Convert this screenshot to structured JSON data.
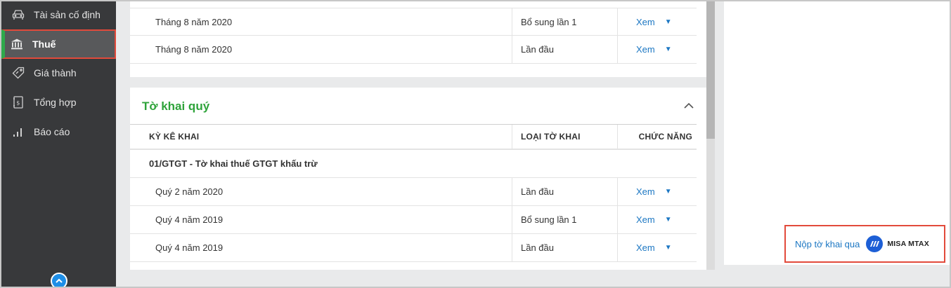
{
  "sidebar": {
    "items": [
      {
        "label": "Tài sản cố định",
        "icon": "car-icon"
      },
      {
        "label": "Thuế",
        "icon": "bank-icon"
      },
      {
        "label": "Giá thành",
        "icon": "price-tag-icon"
      },
      {
        "label": "Tổng hợp",
        "icon": "ledger-icon"
      },
      {
        "label": "Báo cáo",
        "icon": "bar-chart-icon"
      }
    ],
    "active_index": 1
  },
  "monthly_rows": [
    {
      "period": "Tháng 8 năm 2020",
      "type": "Bổ sung lần 1",
      "action": "Xem"
    },
    {
      "period": "Tháng 8 năm 2020",
      "type": "Lần đầu",
      "action": "Xem"
    }
  ],
  "quarterly": {
    "title": "Tờ khai quý",
    "columns": [
      "KỲ KÊ KHAI",
      "LOẠI TỜ KHAI",
      "CHỨC NĂNG"
    ],
    "group": "01/GTGT - Tờ khai thuế GTGT khấu trừ",
    "rows": [
      {
        "period": "Quý 2 năm 2020",
        "type": "Lần đầu",
        "action": "Xem"
      },
      {
        "period": "Quý 4 năm 2019",
        "type": "Bổ sung lần 1",
        "action": "Xem"
      },
      {
        "period": "Quý 4 năm 2019",
        "type": "Lần đầu",
        "action": "Xem"
      }
    ]
  },
  "submit": {
    "label": "Nộp tờ khai qua",
    "brand": "MISA MTAX"
  },
  "colors": {
    "accent_green": "#2ea33a",
    "link_blue": "#1c77c3",
    "highlight_red": "#e24a3b",
    "sidebar_bg": "#38393b"
  }
}
